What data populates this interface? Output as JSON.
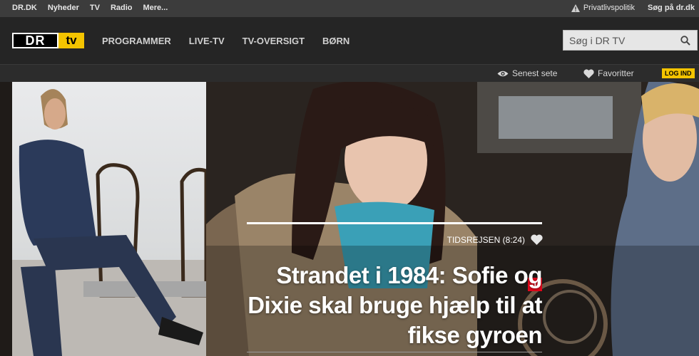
{
  "topbar": {
    "links": [
      "DR.DK",
      "Nyheder",
      "TV",
      "Radio",
      "Mere..."
    ],
    "privacy": "Privatlivspolitik",
    "search_site": "Søg på dr.dk"
  },
  "header": {
    "logo": {
      "dr": "DR",
      "tv": "tv"
    },
    "nav": [
      "PROGRAMMER",
      "LIVE-TV",
      "TV-OVERSIGT",
      "BØRN"
    ],
    "search": {
      "placeholder": "Søg i DR TV"
    }
  },
  "subbar": {
    "recently_watched": "Senest sete",
    "favorites": "Favoritter",
    "login": "LOG IND"
  },
  "hero": {
    "channel_badge": "1",
    "episode": "TIDSREJSEN (8:24)",
    "headline": "Strandet i 1984: Sofie og Dixie skal bruge hjælp til at fikse gyroen"
  },
  "colors": {
    "accent_yellow": "#f4c400",
    "dr1_red": "#e1061a",
    "topbar": "#3c3c3c",
    "header": "#252525"
  }
}
